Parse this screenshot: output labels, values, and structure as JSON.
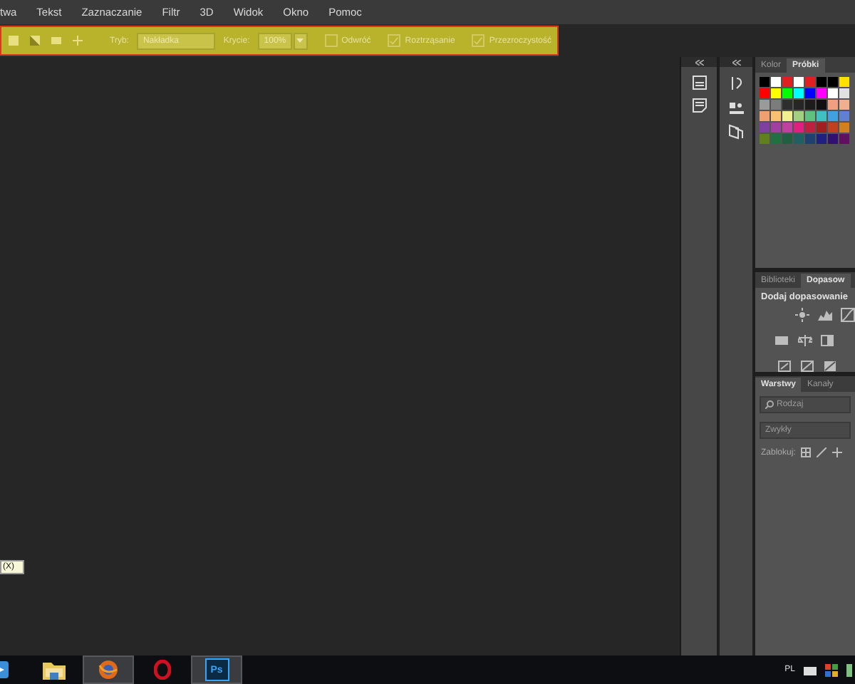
{
  "menu_bar": {
    "items": [
      "twa",
      "Tekst",
      "Zaznaczanie",
      "Filtr",
      "3D",
      "Widok",
      "Okno",
      "Pomoc"
    ]
  },
  "options_bar": {
    "mode_label": "Tryb:",
    "mode_value": "Nakładka",
    "opacity_label": "Krycie:",
    "opacity_value": "100%",
    "checkboxes": [
      {
        "label": "Odwróć",
        "checked": false
      },
      {
        "label": "Roztrząsanie",
        "checked": true
      },
      {
        "label": "Przezroczystość",
        "checked": true
      }
    ]
  },
  "swatches_panel": {
    "tabs": [
      {
        "label": "Kolor",
        "selected": false
      },
      {
        "label": "Próbki",
        "selected": true
      }
    ],
    "rows": [
      {
        "swatches": [
          {
            "color": "#000000"
          },
          {
            "color": "#ffffff"
          },
          {
            "color": "#e02020"
          },
          {
            "color": "#ffffff"
          },
          {
            "color": "#e02020"
          },
          {
            "color": "#000000"
          },
          {
            "color": "#000000"
          },
          {
            "color": "#ffe000"
          }
        ]
      },
      {
        "swatches": [
          {
            "color": "#ff0000"
          },
          {
            "color": "#ffff00"
          },
          {
            "color": "#00ff00"
          },
          {
            "color": "#00ffff"
          },
          {
            "color": "#0000ff"
          },
          {
            "color": "#ff00ff"
          },
          {
            "color": "#ffffff"
          },
          {
            "color": "#e0e0e0"
          }
        ]
      },
      {
        "swatches": [
          {
            "color": "#9a9a9a"
          },
          {
            "color": "#7c7c7c"
          },
          {
            "color": "#2e2e2e"
          },
          {
            "color": "#262626"
          },
          {
            "color": "#1c1c1c"
          },
          {
            "color": "#101010"
          },
          {
            "color": "#f0a080"
          },
          {
            "color": "#f0b090"
          }
        ]
      },
      {
        "swatches": [
          {
            "color": "#f0a070"
          },
          {
            "color": "#f8c070"
          },
          {
            "color": "#f0f090"
          },
          {
            "color": "#a0d080"
          },
          {
            "color": "#60c080"
          },
          {
            "color": "#40c0c0"
          },
          {
            "color": "#40a0e0"
          },
          {
            "color": "#6080d0"
          }
        ]
      },
      {
        "swatches": [
          {
            "color": "#8040a0"
          },
          {
            "color": "#a040a0"
          },
          {
            "color": "#c040a0"
          },
          {
            "color": "#e02080"
          },
          {
            "color": "#c02040"
          },
          {
            "color": "#a02020"
          },
          {
            "color": "#c04020"
          },
          {
            "color": "#d08020"
          }
        ]
      },
      {
        "swatches": [
          {
            "color": "#608020"
          },
          {
            "color": "#207040"
          },
          {
            "color": "#206040"
          },
          {
            "color": "#206060"
          },
          {
            "color": "#204070"
          },
          {
            "color": "#202080"
          },
          {
            "color": "#301070"
          },
          {
            "color": "#601060"
          }
        ]
      }
    ]
  },
  "adjustments_panel": {
    "tabs": [
      {
        "label": "Biblioteki",
        "selected": false
      },
      {
        "label": "Dopasow",
        "selected": true
      }
    ],
    "heading": "Dodaj dopasowanie"
  },
  "layers_panel": {
    "tabs": [
      {
        "label": "Warstwy",
        "selected": true
      },
      {
        "label": "Kanały",
        "selected": false
      }
    ],
    "search_placeholder": "Rodzaj",
    "blend_mode": "Zwykły",
    "lock_label": "Zablokuj:"
  },
  "tooltip": "(X)",
  "taskbar": {
    "apps": [
      {
        "kind": "media",
        "active": false
      },
      {
        "kind": "folder",
        "active": false
      },
      {
        "kind": "browser",
        "active": true
      },
      {
        "kind": "opera",
        "active": false
      },
      {
        "kind": "photoshop",
        "active": true,
        "label": "Ps"
      }
    ],
    "language": "PL"
  }
}
